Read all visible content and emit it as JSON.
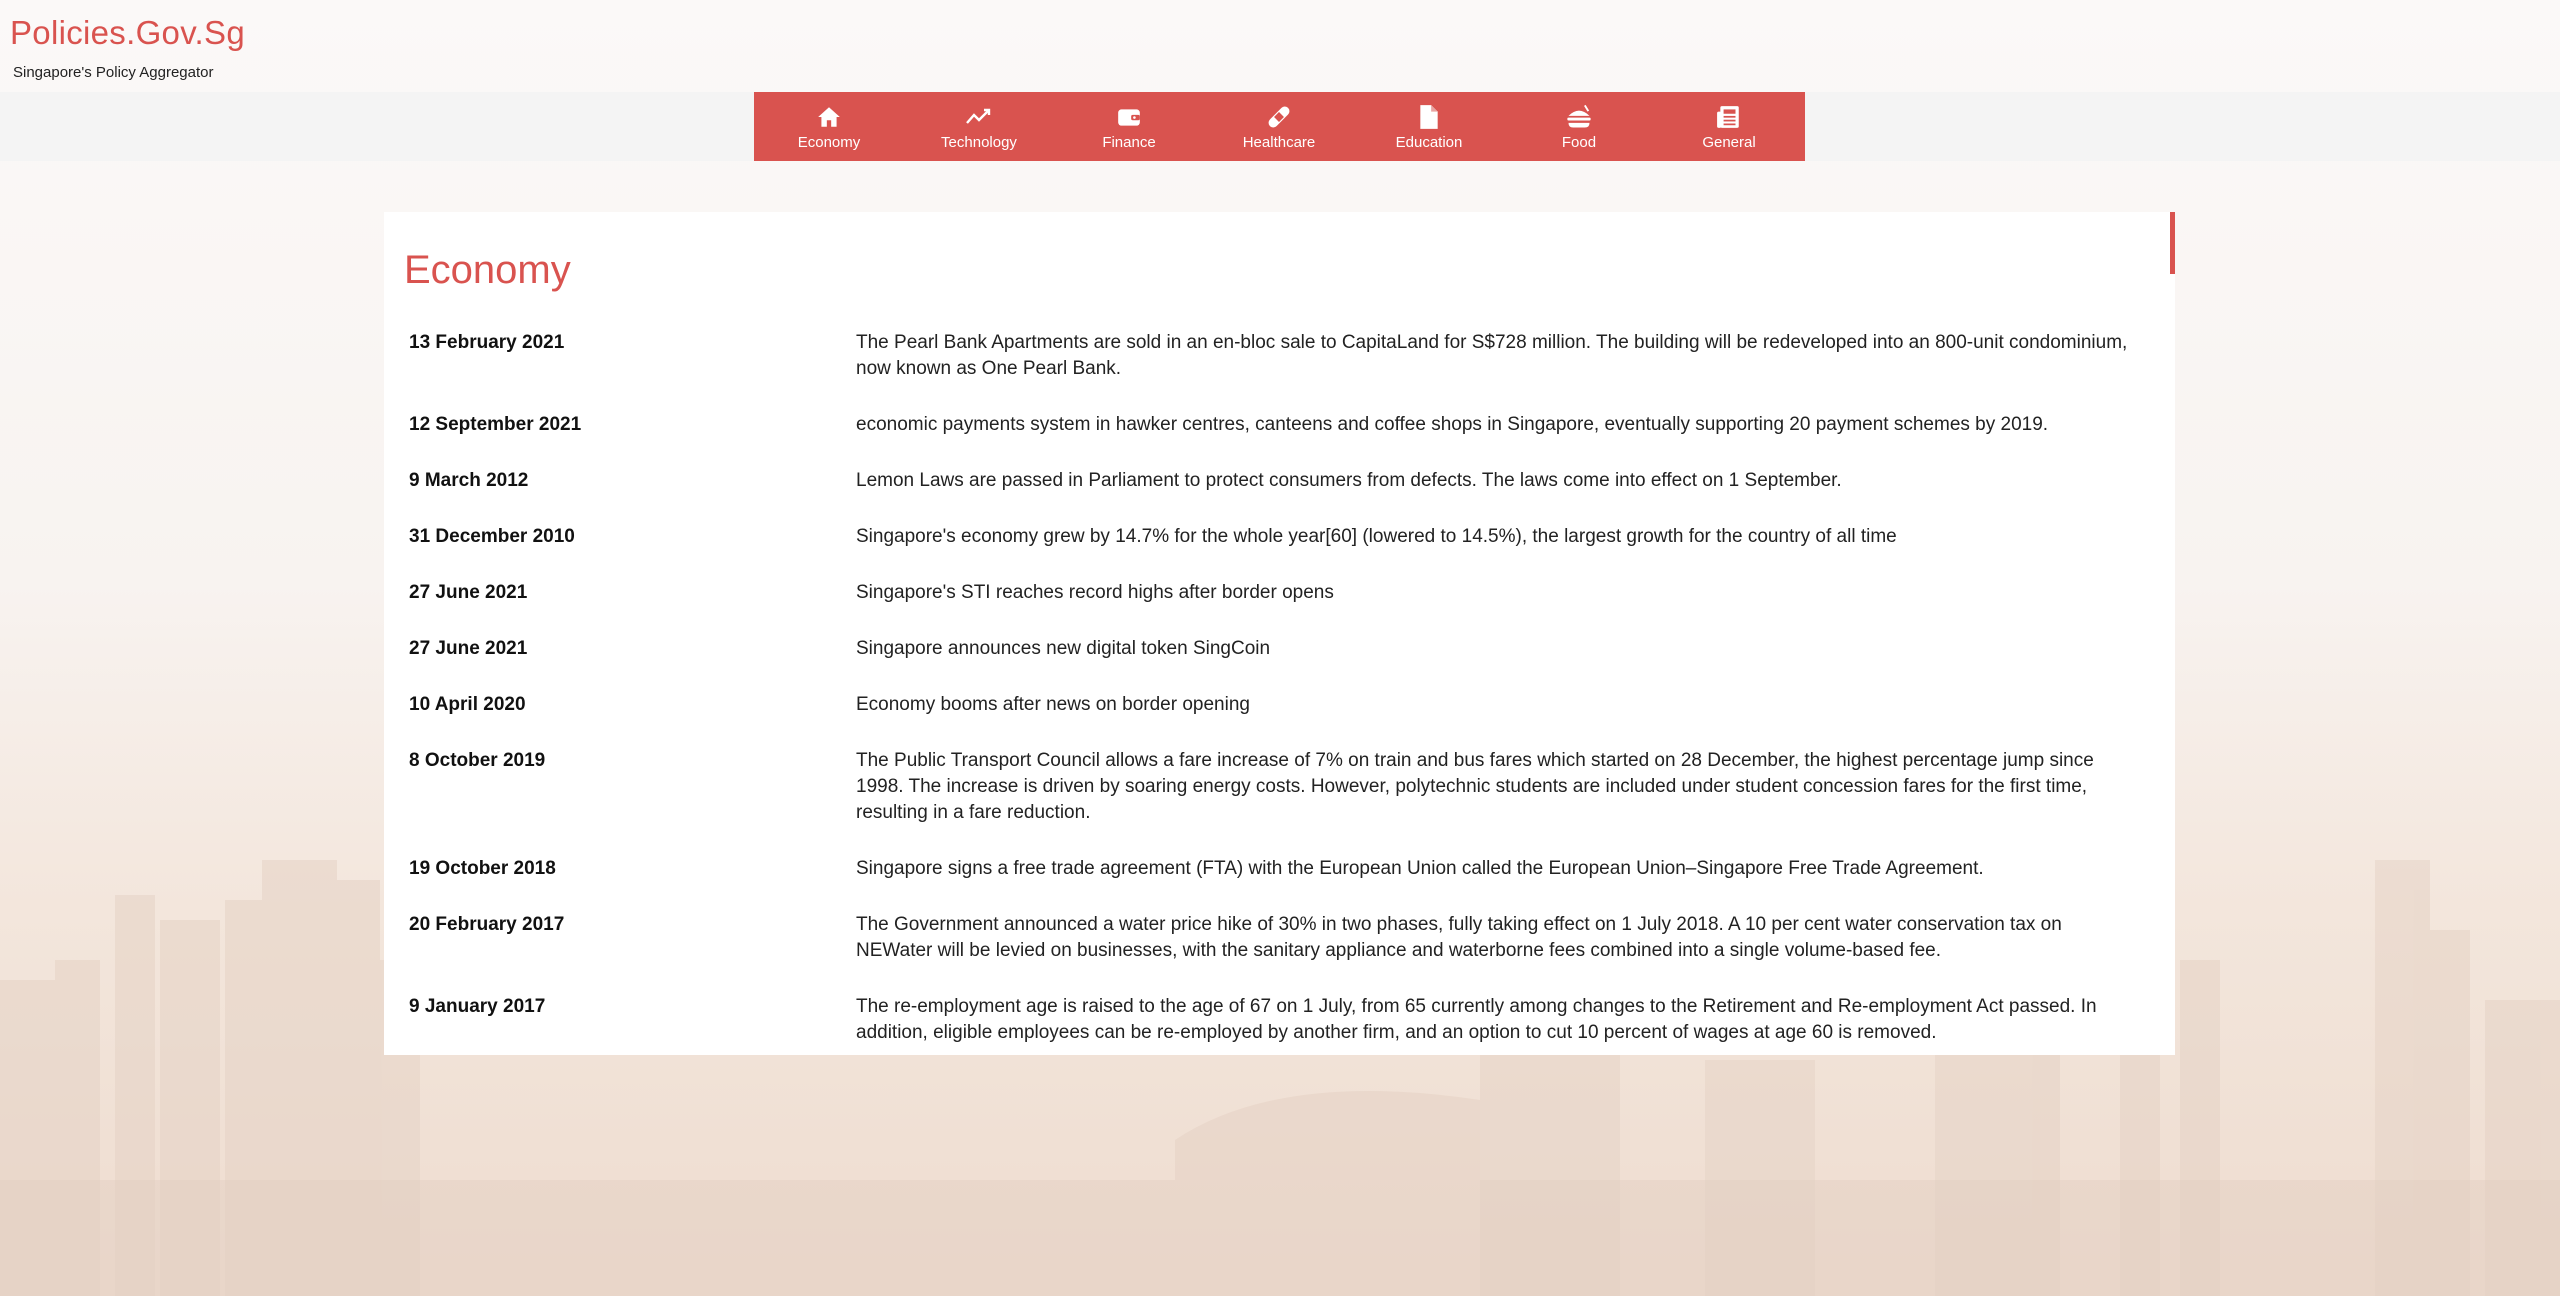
{
  "site": {
    "title": "Policies.Gov.Sg",
    "subtitle": "Singapore's Policy Aggregator"
  },
  "colors": {
    "accent": "#d9534f",
    "nav_band": "#f4f4f4",
    "panel": "#ffffff"
  },
  "nav": {
    "items": [
      {
        "label": "Economy",
        "icon": "home-icon"
      },
      {
        "label": "Technology",
        "icon": "trend-line-icon"
      },
      {
        "label": "Finance",
        "icon": "wallet-icon"
      },
      {
        "label": "Healthcare",
        "icon": "bandage-icon"
      },
      {
        "label": "Education",
        "icon": "file-icon"
      },
      {
        "label": "Food",
        "icon": "burger-icon"
      },
      {
        "label": "General",
        "icon": "newspaper-icon"
      }
    ]
  },
  "main": {
    "title": "Economy",
    "events": [
      {
        "date": "13 February 2021",
        "text": "The Pearl Bank Apartments are sold in an en-bloc sale to CapitaLand for S$728 million. The building will be redeveloped into an 800-unit condominium, now known as One Pearl Bank."
      },
      {
        "date": "12 September 2021",
        "text": "economic payments system in hawker centres, canteens and coffee shops in Singapore, eventually supporting 20 payment schemes by 2019."
      },
      {
        "date": "9 March 2012",
        "text": "Lemon Laws are passed in Parliament to protect consumers from defects. The laws come into effect on 1 September."
      },
      {
        "date": "31 December 2010",
        "text": "Singapore's economy grew by 14.7% for the whole year[60] (lowered to 14.5%), the largest growth for the country of all time"
      },
      {
        "date": "27 June 2021",
        "text": "Singapore's STI reaches record highs after border opens"
      },
      {
        "date": "27 June 2021",
        "text": "Singapore announces new digital token SingCoin"
      },
      {
        "date": "10 April 2020",
        "text": "Economy booms after news on border opening"
      },
      {
        "date": "8 October 2019",
        "text": "The Public Transport Council allows a fare increase of 7% on train and bus fares which started on 28 December, the highest percentage jump since 1998. The increase is driven by soaring energy costs. However, polytechnic students are included under student concession fares for the first time, resulting in a fare reduction."
      },
      {
        "date": "19 October 2018",
        "text": "Singapore signs a free trade agreement (FTA) with the European Union called the European Union–Singapore Free Trade Agreement."
      },
      {
        "date": "20 February 2017",
        "text": "The Government announced a water price hike of 30% in two phases, fully taking effect on 1 July 2018. A 10 per cent water conservation tax on NEWater will be levied on businesses, with the sanitary appliance and waterborne fees combined into a single volume-based fee."
      },
      {
        "date": "9 January 2017",
        "text": "The re-employment age is raised to the age of 67 on 1 July, from 65 currently among changes to the Retirement and Re-employment Act passed. In addition, eligible employees can be re-employed by another firm, and an option to cut 10 percent of wages at age 60 is removed."
      }
    ]
  }
}
